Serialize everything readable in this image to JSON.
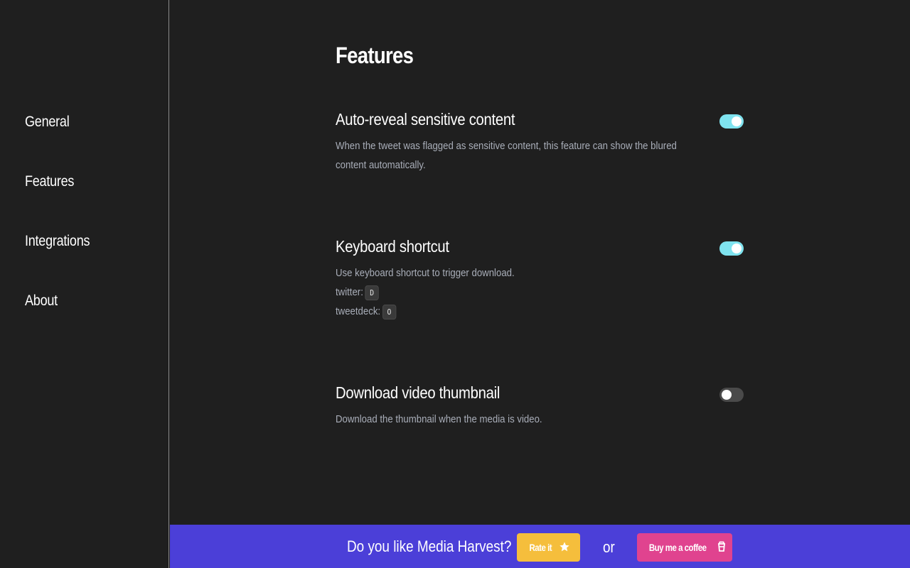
{
  "sidebar": {
    "items": [
      {
        "label": "General"
      },
      {
        "label": "Features"
      },
      {
        "label": "Integrations"
      },
      {
        "label": "About"
      }
    ]
  },
  "main": {
    "title": "Features",
    "features": [
      {
        "title": "Auto-reveal sensitive content",
        "description": "When the tweet was flagged as sensitive content, this feature can show the blured content automatically.",
        "enabled": true
      },
      {
        "title": "Keyboard shortcut",
        "description": "Use keyboard shortcut to trigger download.",
        "twitter_label": "twitter:",
        "twitter_key": "D",
        "tweetdeck_label": "tweetdeck:",
        "tweetdeck_key": "O",
        "enabled": true
      },
      {
        "title": "Download video thumbnail",
        "description": "Download the thumbnail when the media is video.",
        "enabled": false
      }
    ]
  },
  "banner": {
    "question": "Do you like Media Harvest?",
    "rate_label": "Rate it",
    "rate_icon": "star-icon",
    "or_text": "or",
    "coffee_label": "Buy me a coffee",
    "coffee_icon": "coffee-cup-icon"
  },
  "colors": {
    "background": "#1f1f1f",
    "toggle_on": "#7fe3ef",
    "toggle_off": "#4a4a4a",
    "banner": "#4b3fd8",
    "rate_button": "#f5be3c",
    "coffee_button": "#e0438f",
    "description_text": "#a9aeb9"
  }
}
